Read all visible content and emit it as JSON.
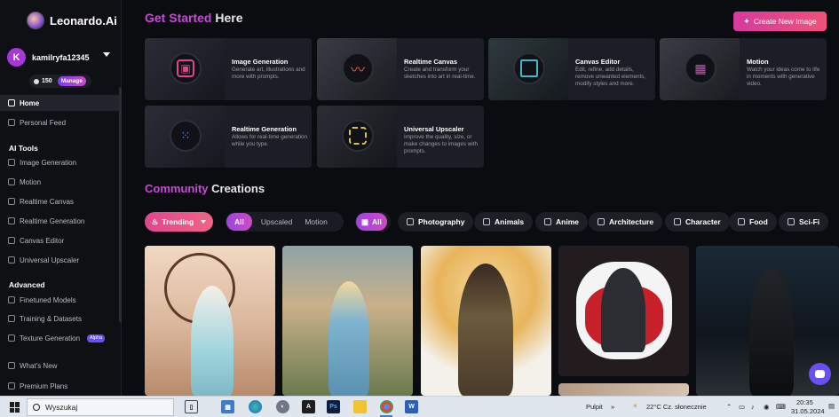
{
  "app": {
    "name": "Leonardo.Ai"
  },
  "user": {
    "initial": "K",
    "name": "kamilryfa12345",
    "credits": "150",
    "manage_label": "Manage"
  },
  "sidebar": {
    "home": "Home",
    "personal_feed": "Personal Feed",
    "ai_tools_label": "AI Tools",
    "ai_tools": [
      "Image Generation",
      "Motion",
      "Realtime Canvas",
      "Realtime Generation",
      "Canvas Editor",
      "Universal Upscaler"
    ],
    "advanced_label": "Advanced",
    "advanced": [
      "Finetuned Models",
      "Training & Datasets",
      "Texture Generation"
    ],
    "alpha_badge": "Alpha",
    "bottom": [
      "What's New",
      "Premium Plans"
    ]
  },
  "header": {
    "title_accent": "Get Started",
    "title_rest": "Here",
    "create_label": "Create New Image"
  },
  "cards": [
    {
      "title": "Image Generation",
      "desc": "Generate art, illustrations and more with prompts.",
      "icon": "image-icon",
      "color": "#e0468f"
    },
    {
      "title": "Realtime Canvas",
      "desc": "Create and transform your sketches into art in real-time.",
      "icon": "brush-icon",
      "color": "#f05a3c"
    },
    {
      "title": "Canvas Editor",
      "desc": "Edit, refine, add details, remove unwanted elements, modify styles and more.",
      "icon": "crop-icon",
      "color": "#3fb7c8"
    },
    {
      "title": "Motion",
      "desc": "Watch your ideas come to life in moments with generative video.",
      "icon": "film-icon",
      "color": "#d04ac6"
    },
    {
      "title": "Realtime Generation",
      "desc": "Allows for real-time generation while you type.",
      "icon": "grid-icon",
      "color": "#5b8cf0"
    },
    {
      "title": "Universal Upscaler",
      "desc": "Improve the quality, size, or make changes to images with prompts.",
      "icon": "upscale-icon",
      "color": "#d8c24a"
    }
  ],
  "community": {
    "title_accent": "Community",
    "title_rest": "Creations"
  },
  "filters": {
    "trending": "Trending",
    "segments": [
      "All",
      "Upscaled",
      "Motion"
    ],
    "categories": [
      "All",
      "Photography",
      "Animals",
      "Anime",
      "Architecture",
      "Character",
      "Food",
      "Sci-Fi"
    ]
  },
  "taskbar": {
    "search_placeholder": "Wyszukaj",
    "desktop_label": "Pulpit",
    "weather": "22°C  Cz. słonecznie",
    "time": "20:35",
    "date": "31.05.2024"
  }
}
